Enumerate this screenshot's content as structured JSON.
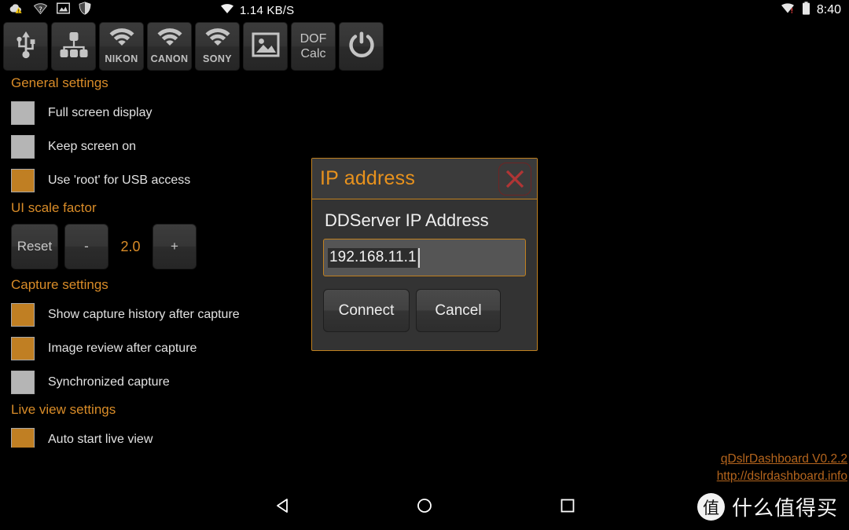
{
  "statusbar": {
    "left_icons": [
      {
        "name": "cloud-warning-icon",
        "label": "cloud sync warning"
      },
      {
        "name": "wifi-unknown-icon",
        "label": "wifi question"
      },
      {
        "name": "screenshot-icon",
        "label": "image"
      },
      {
        "name": "shield-icon",
        "label": "security shield"
      }
    ],
    "network_speed": "1.14 KB/S",
    "network_speed_icon": "wifi-icon",
    "right_wifi_icon": "wifi-alert-icon",
    "battery_icon": "battery-full-icon",
    "time": "8:40"
  },
  "toolbar": {
    "buttons": [
      {
        "name": "usb-connect-button",
        "icon": "usb-icon",
        "label": ""
      },
      {
        "name": "network-connect-button",
        "icon": "network-tree-icon",
        "label": ""
      },
      {
        "name": "nikon-wifi-button",
        "icon": "wifi-icon",
        "label": "NIKON"
      },
      {
        "name": "canon-wifi-button",
        "icon": "wifi-icon",
        "label": "CANON"
      },
      {
        "name": "sony-wifi-button",
        "icon": "wifi-icon",
        "label": "SONY"
      },
      {
        "name": "gallery-button",
        "icon": "image-icon",
        "label": ""
      },
      {
        "name": "dof-calc-button",
        "icon": "",
        "label_line1": "DOF",
        "label_line2": "Calc"
      },
      {
        "name": "power-button",
        "icon": "power-icon",
        "label": ""
      }
    ]
  },
  "settings": {
    "sections": [
      {
        "title": "General settings",
        "rows": [
          {
            "label": "Full screen display",
            "checked": false,
            "name": "full-screen-display"
          },
          {
            "label": "Keep screen on",
            "checked": false,
            "name": "keep-screen-on"
          },
          {
            "label": "Use 'root' for USB access",
            "checked": true,
            "name": "use-root-usb-access"
          }
        ]
      },
      {
        "title": "UI scale factor",
        "scale": {
          "reset_label": "Reset",
          "minus_label": "-",
          "value": "2.0",
          "plus_label": "+"
        }
      },
      {
        "title": "Capture settings",
        "rows": [
          {
            "label": "Show capture history after capture",
            "checked": true,
            "name": "show-capture-history"
          },
          {
            "label": "Image review after capture",
            "checked": true,
            "name": "image-review-after-capture"
          },
          {
            "label": "Synchronized capture",
            "checked": false,
            "name": "synchronized-capture"
          }
        ]
      },
      {
        "title": "Live view settings",
        "rows": [
          {
            "label": "Auto start live view",
            "checked": true,
            "name": "auto-start-live-view"
          }
        ]
      }
    ]
  },
  "dialog": {
    "title": "IP address",
    "close_icon": "close-icon",
    "field_label": "DDServer IP Address",
    "input_value": "192.168.11.1",
    "input_placeholder": "IP address",
    "connect_label": "Connect",
    "cancel_label": "Cancel"
  },
  "footer": {
    "version_link": "qDslrDashboard V0.2.2",
    "site_link": "http://dslrdashboard.info"
  },
  "navbar": {
    "back": "back-button",
    "home": "home-button",
    "recents": "recents-button"
  },
  "watermark": {
    "badge": "值",
    "text": "什么值得买"
  },
  "colors": {
    "accent_orange": "#d98c28",
    "title_orange": "#e8921d",
    "checkbox_on": "#c07f23",
    "checkbox_off": "#b5b5b5",
    "link_orange": "#b5651d",
    "close_red": "#b03535",
    "dialog_bg": "#333333",
    "background": "#000000"
  }
}
